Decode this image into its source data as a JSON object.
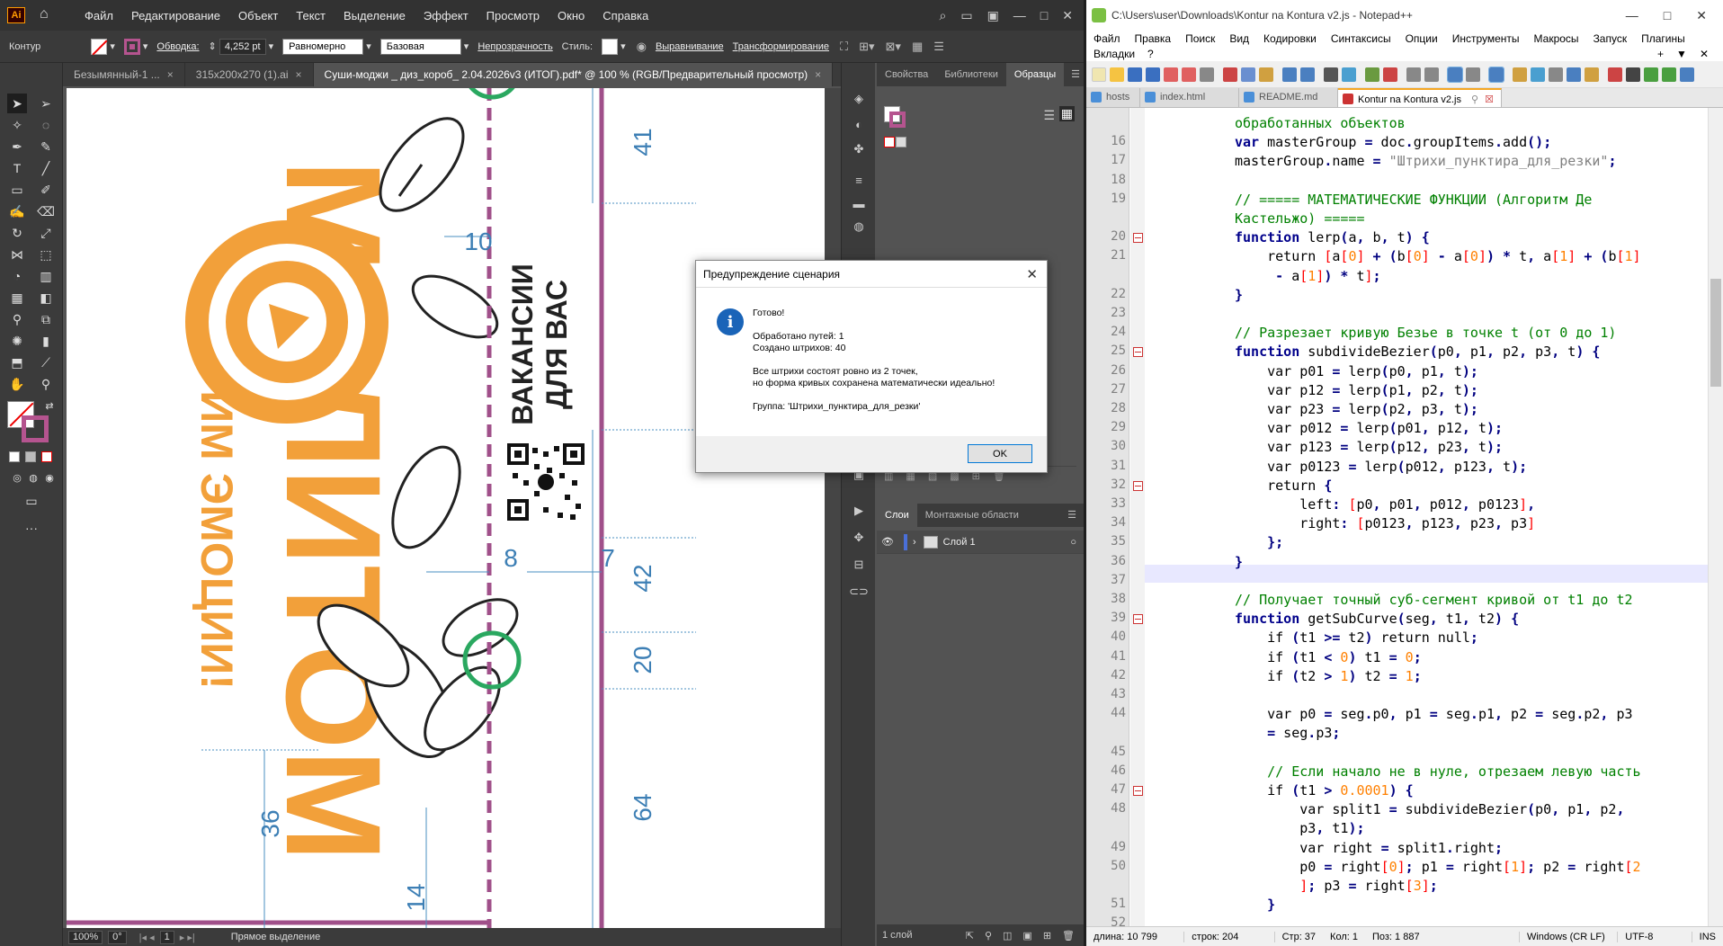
{
  "ai": {
    "menu": [
      "Файл",
      "Редактирование",
      "Объект",
      "Текст",
      "Выделение",
      "Эффект",
      "Просмотр",
      "Окно",
      "Справка"
    ],
    "logo": "Ai",
    "control": {
      "object_label": "Контур",
      "stroke_label": "Обводка:",
      "stroke_value": "4,252 pt",
      "profile": "Равномерно",
      "brush": "Базовая",
      "opacity": "Непрозрачность",
      "style": "Стиль:",
      "align": "Выравнивание",
      "transform": "Трансформирование"
    },
    "tabs": [
      {
        "label": "Безымянный-1 ...",
        "close": "×"
      },
      {
        "label": "315x200x270 (1).ai",
        "close": "×"
      },
      {
        "label": "Суши-моджи _ диз_короб_ 2.04.2026v3 (ИТОГ).pdf* @ 100 % (RGB/Предварительный просмотр)",
        "close": "×"
      }
    ],
    "panels": {
      "top_tabs": [
        "Свойства",
        "Библиотеки",
        "Образцы"
      ],
      "layers_tabs": [
        "Слои",
        "Монтажные области"
      ],
      "layer_name": "Слой 1",
      "layers_count": "1 слой"
    },
    "status": {
      "zoom": "100%",
      "angle": "0°",
      "page": "1",
      "tool": "Прямое выделение"
    },
    "artwork": {
      "brand_big": "МОЛИТОМ",
      "brand_sub": "ДАРИМ ЭМОЦИИ!",
      "vacancy_line1": "ВАКАНСИИ",
      "vacancy_line2": "ДЛЯ ВАС",
      "dims": [
        "41",
        "10",
        "8",
        "7",
        "42",
        "20",
        "64",
        "36",
        "14"
      ]
    }
  },
  "dialog": {
    "title": "Предупреждение сценария",
    "close": "✕",
    "line1": "Готово!",
    "line2": "Обработано путей: 1",
    "line3": "Создано штрихов: 40",
    "line4": "Все штрихи состоят ровно из 2 точек,",
    "line5": "но форма кривых сохранена математически идеально!",
    "line6": "Группа: 'Штрихи_пунктира_для_резки'",
    "ok": "OK",
    "icon": "i"
  },
  "np": {
    "title": "C:\\Users\\user\\Downloads\\Kontur na Kontura v2.js - Notepad++",
    "menu": [
      "Файл",
      "Правка",
      "Поиск",
      "Вид",
      "Кодировки",
      "Синтаксисы",
      "Опции",
      "Инструменты",
      "Макросы",
      "Запуск",
      "Плагины"
    ],
    "menu2": [
      "Вкладки",
      "?"
    ],
    "tabs": [
      "hosts",
      "index.html",
      "README.md",
      "Kontur na Kontura v2.js"
    ],
    "status": {
      "length": "длина: 10 799",
      "lines": "строк: 204",
      "line": "Стр: 37",
      "col": "Кол: 1",
      "pos": "Поз: 1 887",
      "eol": "Windows (CR LF)",
      "enc": "UTF-8",
      "mode": "INS"
    },
    "lines": [
      {
        "n": "",
        "t": "обработанных объектов"
      },
      {
        "n": "16",
        "t": "var masterGroup = doc.groupItems.add();"
      },
      {
        "n": "17",
        "t": "masterGroup.name = \"Штрихи_пунктира_для_резки\";"
      },
      {
        "n": "18",
        "t": ""
      },
      {
        "n": "19",
        "t": "// ===== МАТЕМАТИЧЕСКИЕ ФУНКЦИИ (Алгоритм Де"
      },
      {
        "n": "",
        "t": "Кастельжо) ====="
      },
      {
        "n": "20",
        "t": "function lerp(a, b, t) {"
      },
      {
        "n": "21",
        "t": "    return [a[0] + (b[0] - a[0]) * t, a[1] + (b[1]"
      },
      {
        "n": "",
        "t": "     - a[1]) * t];"
      },
      {
        "n": "22",
        "t": "}"
      },
      {
        "n": "23",
        "t": ""
      },
      {
        "n": "24",
        "t": "// Разрезает кривую Безье в точке t (от 0 до 1)"
      },
      {
        "n": "25",
        "t": "function subdivideBezier(p0, p1, p2, p3, t) {"
      },
      {
        "n": "26",
        "t": "    var p01 = lerp(p0, p1, t);"
      },
      {
        "n": "27",
        "t": "    var p12 = lerp(p1, p2, t);"
      },
      {
        "n": "28",
        "t": "    var p23 = lerp(p2, p3, t);"
      },
      {
        "n": "29",
        "t": "    var p012 = lerp(p01, p12, t);"
      },
      {
        "n": "30",
        "t": "    var p123 = lerp(p12, p23, t);"
      },
      {
        "n": "31",
        "t": "    var p0123 = lerp(p012, p123, t);"
      },
      {
        "n": "32",
        "t": "    return {"
      },
      {
        "n": "33",
        "t": "        left: [p0, p01, p012, p0123],"
      },
      {
        "n": "34",
        "t": "        right: [p0123, p123, p23, p3]"
      },
      {
        "n": "35",
        "t": "    };"
      },
      {
        "n": "36",
        "t": "}"
      },
      {
        "n": "37",
        "t": ""
      },
      {
        "n": "38",
        "t": "// Получает точный суб-сегмент кривой от t1 до t2"
      },
      {
        "n": "39",
        "t": "function getSubCurve(seg, t1, t2) {"
      },
      {
        "n": "40",
        "t": "    if (t1 >= t2) return null;"
      },
      {
        "n": "41",
        "t": "    if (t1 < 0) t1 = 0;"
      },
      {
        "n": "42",
        "t": "    if (t2 > 1) t2 = 1;"
      },
      {
        "n": "43",
        "t": ""
      },
      {
        "n": "44",
        "t": "    var p0 = seg.p0, p1 = seg.p1, p2 = seg.p2, p3"
      },
      {
        "n": "",
        "t": "    = seg.p3;"
      },
      {
        "n": "45",
        "t": ""
      },
      {
        "n": "46",
        "t": "    // Если начало не в нуле, отрезаем левую часть"
      },
      {
        "n": "47",
        "t": "    if (t1 > 0.0001) {"
      },
      {
        "n": "48",
        "t": "        var split1 = subdivideBezier(p0, p1, p2,"
      },
      {
        "n": "",
        "t": "        p3, t1);"
      },
      {
        "n": "49",
        "t": "        var right = split1.right;"
      },
      {
        "n": "50",
        "t": "        p0 = right[0]; p1 = right[1]; p2 = right[2"
      },
      {
        "n": "",
        "t": "        ]; p3 = right[3];"
      },
      {
        "n": "51",
        "t": "    }"
      },
      {
        "n": "52",
        "t": ""
      }
    ]
  }
}
